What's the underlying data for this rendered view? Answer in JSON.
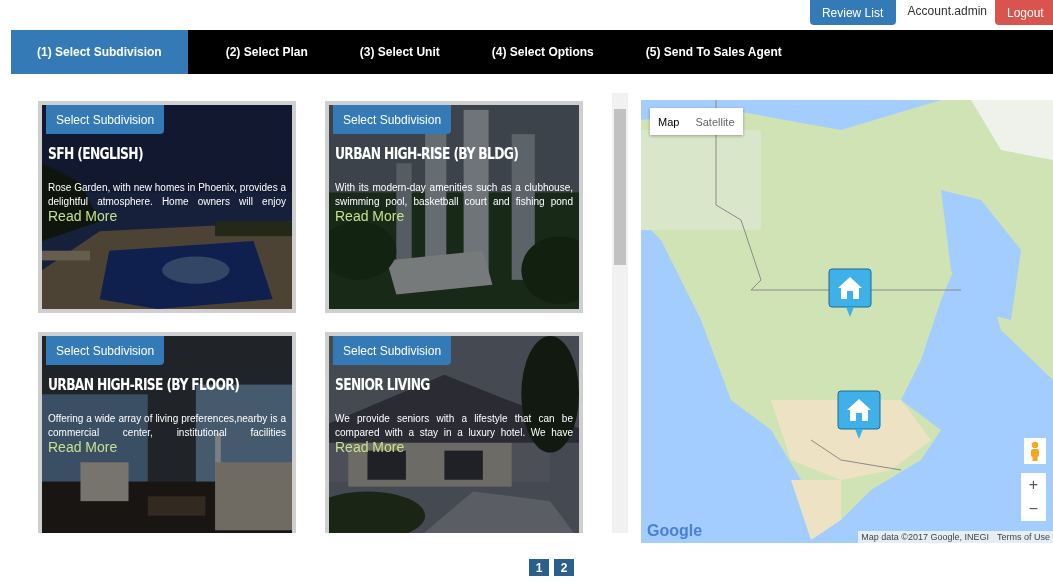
{
  "header": {
    "buttons": [
      {
        "label": "Review List",
        "kind": "primary"
      },
      {
        "label": "Logout",
        "kind": "danger"
      }
    ],
    "account": "Account.admin"
  },
  "steps": [
    {
      "label": "(1) Select Subdivision",
      "selected": true
    },
    {
      "label": "(2) Select Plan",
      "selected": false
    },
    {
      "label": "(3) Select Unit",
      "selected": false
    },
    {
      "label": "(4) Select Options",
      "selected": false
    },
    {
      "label": "(5) Send To Sales Agent",
      "selected": false
    }
  ],
  "subdivisions": [
    {
      "button": "Select Subdivision",
      "title": "SFH (ENGLISH)",
      "description": "Rose Garden, with new homes in Phoenix, provides a delightful atmosphere. Home owners will enjoy",
      "link": "Read More",
      "kind": "picture"
    },
    {
      "button": "Select Subdivision",
      "title": "URBAN HIGH-RISE (BY BLDG)",
      "description": "With its modern-day amenities such as a clubhouse, swimming pool, basketball court and fishing pond",
      "link": "Read More",
      "kind": "picture"
    },
    {
      "button": "Select Subdivision",
      "title": "URBAN HIGH-RISE (BY FLOOR)",
      "description": "Offering a wide array of living preferences,nearby is a commercial center, institutional facilities",
      "link": "Read More",
      "kind": "picture"
    },
    {
      "button": "Select Subdivision",
      "title": "SENIOR LIVING",
      "description": "We provide seniors with a lifestyle that can be compared with a stay in a luxury hotel. We have",
      "link": "Read More",
      "kind": "picture"
    }
  ],
  "map": {
    "map_types": [
      {
        "label": "Map",
        "selected": true
      },
      {
        "label": "Satellite",
        "selected": false
      }
    ],
    "markers": [
      {
        "kind": "house"
      },
      {
        "kind": "house"
      }
    ],
    "logo": "Google",
    "attribution": "Map data ©2017 Google, INEGI",
    "terms": "Terms of Use",
    "zoom_in": "+",
    "zoom_out": "−"
  },
  "pagination": [
    {
      "label": "1"
    },
    {
      "label": "2"
    }
  ]
}
